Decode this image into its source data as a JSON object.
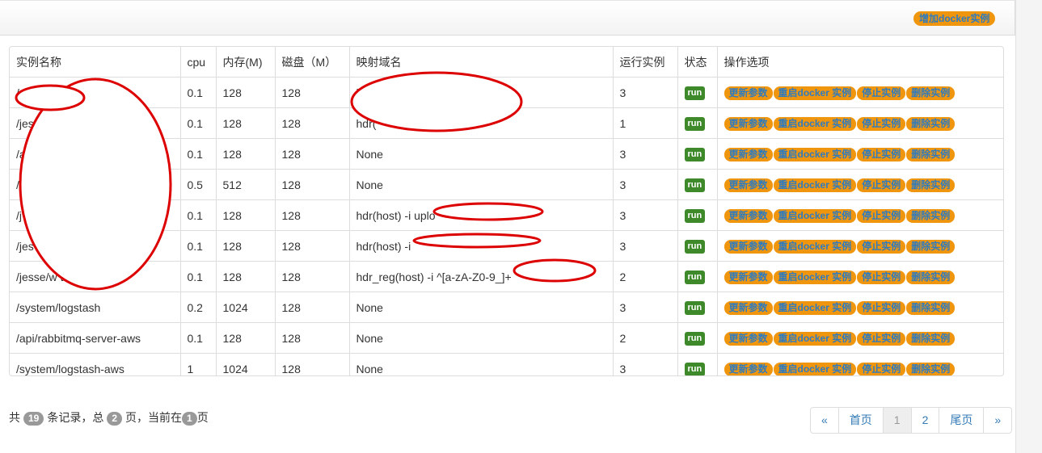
{
  "toolbar": {
    "add_label": "增加docker实例"
  },
  "table": {
    "headers": [
      "实例名称",
      "cpu",
      "内存(M)",
      "磁盘（M）",
      "映射域名",
      "运行实例",
      "状态",
      "操作选项"
    ],
    "rows": [
      {
        "name": "/a",
        "cpu": "0.1",
        "mem": "128",
        "disk": "128",
        "domain": "h",
        "instances": "3",
        "status": "run"
      },
      {
        "name": "/jesse",
        "cpu": "0.1",
        "mem": "128",
        "disk": "128",
        "domain": "hdr(",
        "instances": "1",
        "status": "run"
      },
      {
        "name": "/a",
        "cpu": "0.1",
        "mem": "128",
        "disk": "128",
        "domain": "None",
        "instances": "3",
        "status": "run"
      },
      {
        "name": "/",
        "cpu": "0.5",
        "mem": "512",
        "disk": "128",
        "domain": "None",
        "instances": "3",
        "status": "run"
      },
      {
        "name": "/j",
        "cpu": "0.1",
        "mem": "128",
        "disk": "128",
        "domain": "hdr(host) -i uplo",
        "instances": "3",
        "status": "run"
      },
      {
        "name": "/jes",
        "cpu": "0.1",
        "mem": "128",
        "disk": "128",
        "domain": "hdr(host) -i",
        "instances": "3",
        "status": "run"
      },
      {
        "name": "/jesse/w                          test",
        "cpu": "0.1",
        "mem": "128",
        "disk": "128",
        "domain": "hdr_reg(host) -i ^[a-zA-Z0-9_]+",
        "instances": "2",
        "status": "run"
      },
      {
        "name": "/system/logstash",
        "cpu": "0.2",
        "mem": "1024",
        "disk": "128",
        "domain": "None",
        "instances": "3",
        "status": "run"
      },
      {
        "name": "/api/rabbitmq-server-aws",
        "cpu": "0.1",
        "mem": "128",
        "disk": "128",
        "domain": "None",
        "instances": "2",
        "status": "run"
      },
      {
        "name": "/system/logstash-aws",
        "cpu": "1",
        "mem": "1024",
        "disk": "128",
        "domain": "None",
        "instances": "3",
        "status": "run"
      }
    ],
    "actions": [
      "更新参数",
      "重启docker 实例",
      "停止实例",
      "删除实例"
    ]
  },
  "footer": {
    "prefix": "共",
    "total": "19",
    "mid1": "条记录，总",
    "pages": "2",
    "mid2": "页，当前在",
    "current": "1",
    "suffix": "页"
  },
  "pager": [
    "«",
    "首页",
    "1",
    "2",
    "尾页",
    "»"
  ],
  "colors": {
    "accent": "#f0960e",
    "link": "#2f7bbf",
    "status": "#3e8a2a",
    "annotation": "#dd0000"
  }
}
